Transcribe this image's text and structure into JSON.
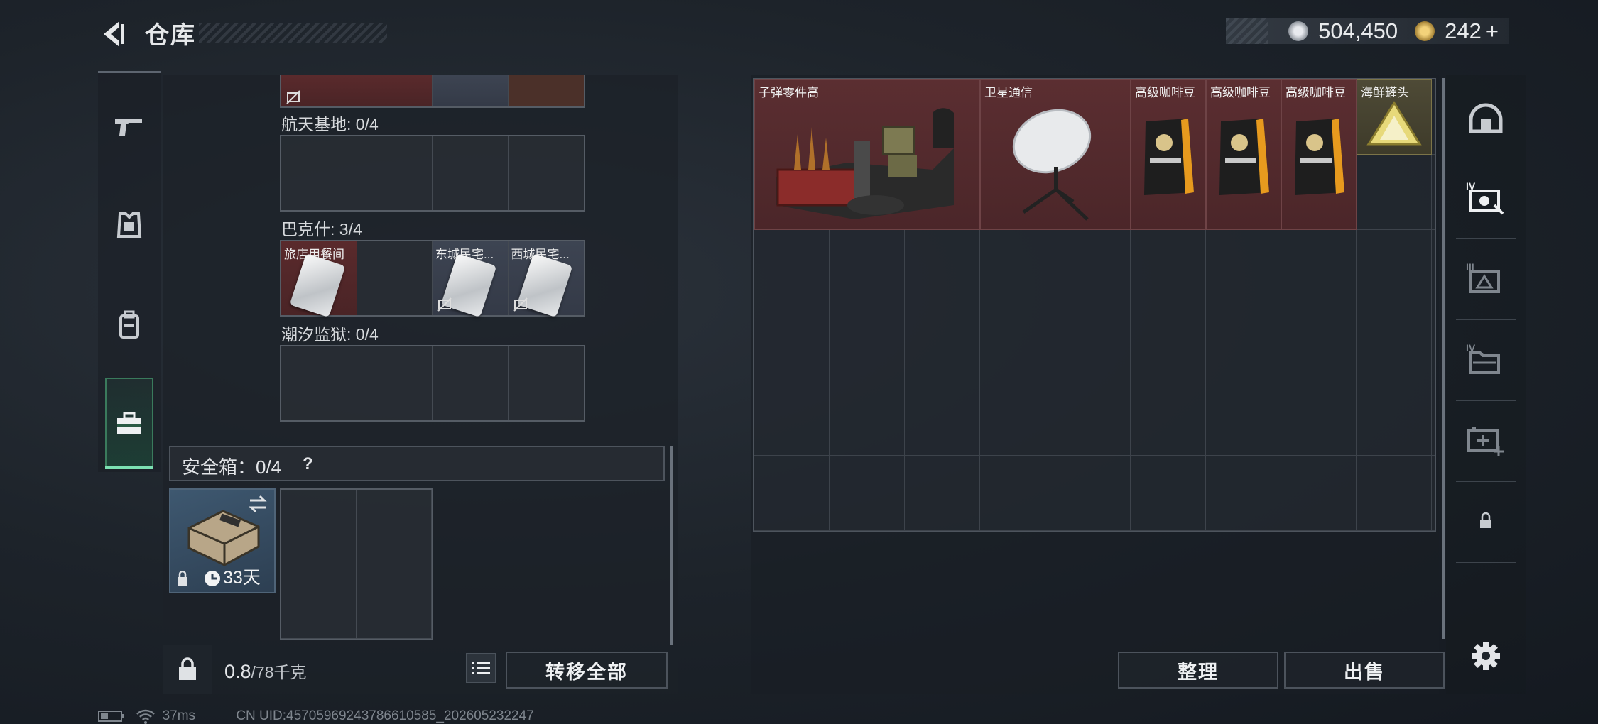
{
  "header": {
    "title": "仓库",
    "currency_silver": "504,450",
    "currency_gold": "242",
    "currency_add": "+"
  },
  "left_sidebar": {
    "items": [
      "pistol-icon",
      "armor-icon",
      "backpack-icon",
      "toolbox-icon"
    ],
    "active": "toolbox-icon"
  },
  "keycard_sections": [
    {
      "label": "航天基地: 0/4",
      "slots": [
        "",
        "",
        "",
        ""
      ]
    },
    {
      "label": "巴克什: 3/4",
      "slots": [
        "旅店用餐间",
        "",
        "东城民宅...",
        "西城民宅..."
      ]
    },
    {
      "label": "潮汐监狱: 0/4",
      "slots": [
        "",
        "",
        "",
        ""
      ]
    }
  ],
  "safe_box": {
    "label": "安全箱：0/4",
    "help": "?",
    "days": "33天"
  },
  "bottom": {
    "weight_value": "0.8",
    "weight_max": "/78千克",
    "transfer_all": "转移全部"
  },
  "stash_items": [
    {
      "name": "子弹零件高",
      "rarity": "red"
    },
    {
      "name": "卫星通信",
      "rarity": "red"
    },
    {
      "name": "高级咖啡豆",
      "rarity": "red"
    },
    {
      "name": "高级咖啡豆",
      "rarity": "red"
    },
    {
      "name": "高级咖啡豆",
      "rarity": "red"
    },
    {
      "name": "海鲜罐头",
      "rarity": "gold"
    }
  ],
  "stash_actions": {
    "sort": "整理",
    "sell": "出售"
  },
  "right_sidebar": {
    "items": [
      "helmet-icon",
      "container-iv-icon",
      "container-iii-icon",
      "container-iv-folder-icon",
      "medical-add-icon",
      "lock-icon",
      "settings-icon"
    ]
  },
  "status": {
    "ping": "37ms",
    "uid": "CN UID:45705969243786610585_202605232247"
  },
  "colors": {
    "accent_green": "#7ce0b2",
    "rarity_red": "#5b2e31",
    "rarity_gold": "#4e4a36"
  }
}
